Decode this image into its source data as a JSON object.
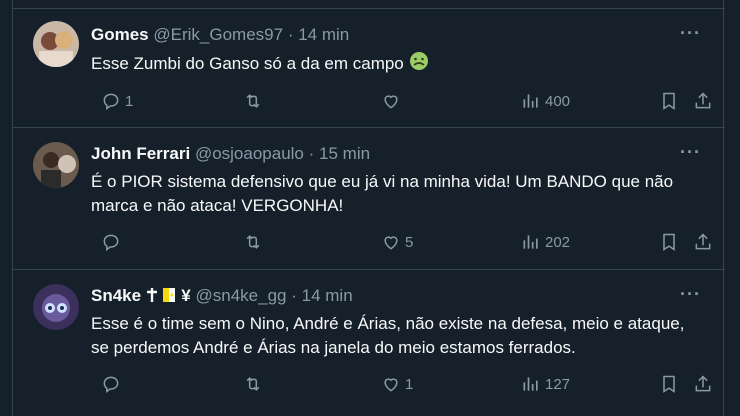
{
  "tweets": [
    {
      "name": "Gomes",
      "handle": "@Erik_Gomes97",
      "sep": "·",
      "time": "14 min",
      "text": "Esse Zumbi do Ganso só a da em campo",
      "emoji": "nauseated-face",
      "more": "···",
      "replies": "1",
      "retweets": "",
      "likes": "",
      "views": "400"
    },
    {
      "name": "John Ferrari",
      "handle": "@osjoaopaulo",
      "sep": "·",
      "time": "15 min",
      "text": "É o PIOR sistema defensivo que eu já vi na minha vida! Um BANDO que não marca e não ataca! VERGONHA!",
      "more": "···",
      "replies": "",
      "retweets": "",
      "likes": "5",
      "views": "202"
    },
    {
      "name": "Sn4ke",
      "name_suffix": "¥",
      "handle": "@sn4ke_gg",
      "sep": "·",
      "time": "14 min",
      "text": "Esse é o time sem o Nino, André e Árias, não existe na defesa, meio e ataque, se perdemos André e Árias na janela do meio estamos ferrados.",
      "more": "···",
      "replies": "",
      "retweets": "",
      "likes": "1",
      "views": "127"
    }
  ],
  "colors": {
    "background": "#15202b",
    "border": "#38444d",
    "text": "#f7f9f9",
    "muted": "#8b98a5"
  }
}
